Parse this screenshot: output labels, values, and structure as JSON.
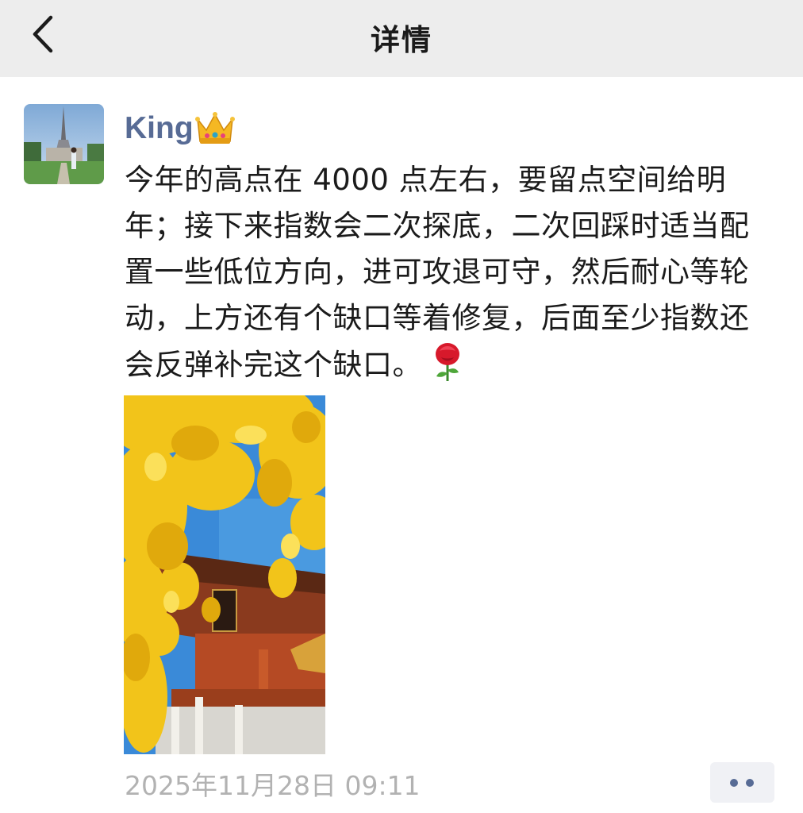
{
  "header": {
    "title": "详情",
    "back_icon": "chevron-left-icon"
  },
  "post": {
    "author": "King",
    "author_emoji": "crown-icon",
    "text": "今年的高点在 4000 点左右，要留点空间给明年；接下来指数会二次探底，二次回踩时适当配置一些低位方向，进可攻退可守，然后耐心等轮动，上方还有个缺口等着修复，后面至少指数还会反弹补完这个缺口。",
    "text_emoji": "rose-icon",
    "timestamp": "2025年11月28日 09:11",
    "more_icon": "more-dots-icon"
  },
  "colors": {
    "header_bg": "#ededed",
    "author_name": "#576b95",
    "body_text": "#1b1b1b",
    "timestamp": "#b2b2b2",
    "more_bg": "#f0f1f5"
  }
}
